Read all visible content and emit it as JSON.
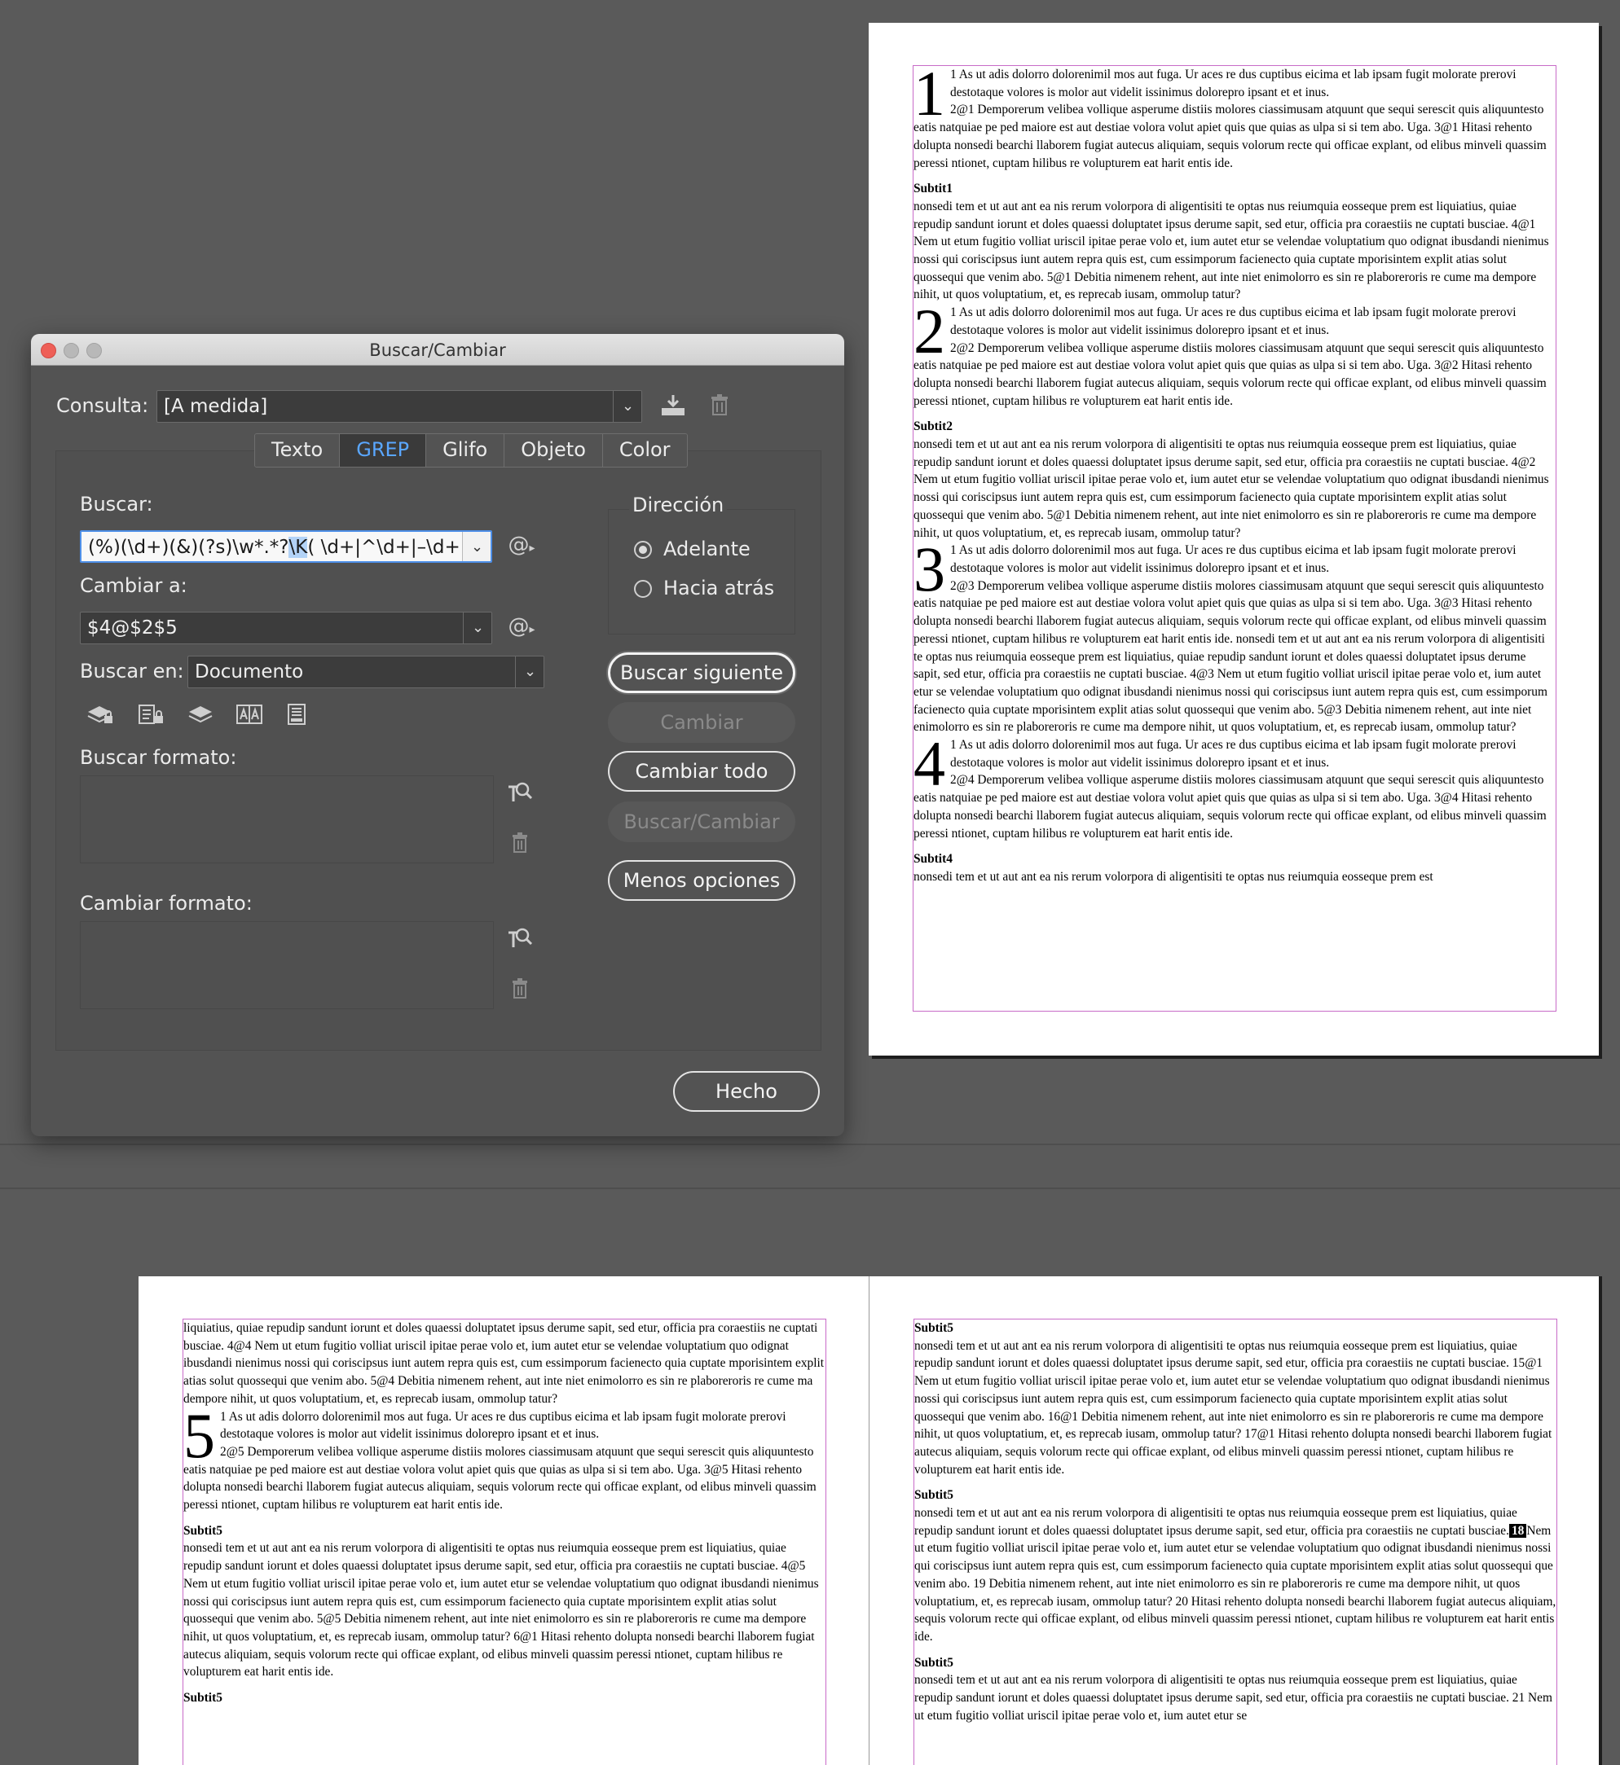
{
  "dialog": {
    "title": "Buscar/Cambiar",
    "query_label": "Consulta:",
    "query_value": "[A medida]",
    "tabs": [
      {
        "label": "Texto"
      },
      {
        "label": "GREP"
      },
      {
        "label": "Glifo"
      },
      {
        "label": "Objeto"
      },
      {
        "label": "Color"
      }
    ],
    "find_label": "Buscar:",
    "find_before": "(%)(\\d+)(&)(?s)\\w*.*?",
    "find_selected": "\\K",
    "find_after": "( \\d+|^\\d+|–\\d+",
    "change_label": "Cambiar a:",
    "change_value": "$4@$2$5",
    "search_in_label": "Buscar en:",
    "search_in_value": "Documento",
    "find_format_label": "Buscar formato:",
    "change_format_label": "Cambiar formato:",
    "direction_label": "Dirección",
    "forward_label": "Adelante",
    "backward_label": "Hacia atrás",
    "btn_find_next": "Buscar siguiente",
    "btn_change": "Cambiar",
    "btn_change_all": "Cambiar todo",
    "btn_find_change": "Buscar/Cambiar",
    "btn_fewer": "Menos opciones",
    "btn_done": "Hecho",
    "special_char_glyph": "@",
    "dropdown_glyph": "⌄"
  },
  "doc": {
    "top_page": {
      "sections": [
        {
          "num": "1",
          "p1": "1 As ut adis dolorro dolorenimil mos aut fuga. Ur aces re dus cuptibus eicima et lab ipsam fugit molorate prerovi destotaque volores is molor aut videlit issinimus dolorepro ipsant et et inus.",
          "p2": "2@1 Demporerum velibea vollique asperume distiis molores ciassimusam atquunt que sequi serescit quis aliquuntesto eatis natquiae pe ped maiore est aut destiae volora volut apiet quis que quias as ulpa si si tem abo. Uga. 3@1 Hitasi rehento dolupta nonsedi bearchi llaborem fugiat autecus aliquiam, sequis volorum recte qui officae explant, od elibus minveli quassim peressi ntionet, cuptam hilibus re volupturem eat harit entis ide.",
          "sub": "Subtit1",
          "p3": "nonsedi tem et ut aut ant ea nis rerum volorpora di aligentisiti te optas nus reiumquia eosseque prem est liquiatius, quiae repudip sandunt iorunt et doles quaessi doluptatet ipsus derume sapit, sed etur, officia pra coraestiis ne cuptati busciae. 4@1 Nem ut etum fugitio volliat uriscil ipitae perae volo et, ium autet etur se velendae voluptatium quo odignat ibusdandi nienimus nossi qui coriscipsus iunt autem repra quis est, cum essimporum facienecto quia cuptate mporisintem explit atias solut quossequi que venim abo. 5@1 Debitia nimenem rehent, aut inte niet enimolorro es sin re plaboreroris re cume ma dempore nihit, ut quos voluptatium, et, es reprecab iusam, ommolup tatur?"
        },
        {
          "num": "2",
          "p1": "1 As ut adis dolorro dolorenimil mos aut fuga. Ur aces re dus cuptibus eicima et lab ipsam fugit molorate prerovi destotaque volores is molor aut videlit issinimus dolorepro ipsant et et inus.",
          "p2": "2@2 Demporerum velibea vollique asperume distiis molores ciassimusam atquunt que sequi serescit quis aliquuntesto eatis natquiae pe ped maiore est aut destiae volora volut apiet quis que quias as ulpa si si tem abo. Uga. 3@2 Hitasi rehento dolupta nonsedi bearchi llaborem fugiat autecus aliquiam, sequis volorum recte qui officae explant, od elibus minveli quassim peressi ntionet, cuptam hilibus re volupturem eat harit entis ide.",
          "sub": "Subtit2",
          "p3": "nonsedi tem et ut aut ant ea nis rerum volorpora di aligentisiti te optas nus reiumquia eosseque prem est liquiatius, quiae repudip sandunt iorunt et doles quaessi doluptatet ipsus derume sapit, sed etur, officia pra coraestiis ne cuptati busciae. 4@2 Nem ut etum fugitio volliat uriscil ipitae perae volo et, ium autet etur se velendae voluptatium quo odignat ibusdandi nienimus nossi qui coriscipsus iunt autem repra quis est, cum essimporum facienecto quia cuptate mporisintem explit atias solut quossequi que venim abo. 5@1 Debitia nimenem rehent, aut inte niet enimolorro es sin re plaboreroris re cume ma dempore nihit, ut quos voluptatium, et, es reprecab iusam, ommolup tatur?"
        },
        {
          "num": "3",
          "p1": "1 As ut adis dolorro dolorenimil mos aut fuga. Ur aces re dus cuptibus eicima et lab ipsam fugit molorate prerovi destotaque volores is molor aut videlit issinimus dolorepro ipsant et et inus.",
          "p2": "2@3 Demporerum velibea vollique asperume distiis molores ciassimusam atquunt que sequi serescit quis aliquuntesto eatis natquiae pe ped maiore est aut destiae volora volut apiet quis que quias as ulpa si si tem abo. Uga. 3@3 Hitasi rehento dolupta nonsedi bearchi llaborem fugiat autecus aliquiam, sequis volorum recte qui officae explant, od elibus minveli quassim peressi ntionet, cuptam hilibus re volupturem eat harit entis ide. nonsedi tem et ut aut ant ea nis rerum volorpora di aligentisiti te optas nus reiumquia eosseque prem est liquiatius, quiae repudip sandunt iorunt et doles quaessi doluptatet ipsus derume sapit, sed etur, officia pra coraestiis ne cuptati busciae. 4@3 Nem ut etum fugitio volliat uriscil ipitae perae volo et, ium autet etur se velendae voluptatium quo odignat ibusdandi nienimus nossi qui coriscipsus iunt autem repra quis est, cum essimporum facienecto quia cuptate mporisintem explit atias solut quossequi que venim abo. 5@3 Debitia nimenem rehent, aut inte niet enimolorro es sin re plaboreroris re cume ma dempore nihit, ut quos voluptatium, et, es reprecab iusam, ommolup tatur?",
          "sub": "",
          "p3": ""
        },
        {
          "num": "4",
          "p1": "1 As ut adis dolorro dolorenimil mos aut fuga. Ur aces re dus cuptibus eicima et lab ipsam fugit molorate prerovi destotaque volores is molor aut videlit issinimus dolorepro ipsant et et inus.",
          "p2": "2@4 Demporerum velibea vollique asperume distiis molores ciassimusam atquunt que sequi serescit quis aliquuntesto eatis natquiae pe ped maiore est aut destiae volora volut apiet quis que quias as ulpa si si tem abo. Uga. 3@4 Hitasi rehento dolupta nonsedi bearchi llaborem fugiat autecus aliquiam, sequis volorum recte qui officae explant, od elibus minveli quassim peressi ntionet, cuptam hilibus re volupturem eat harit entis ide.",
          "sub": "Subtit4",
          "p3": "nonsedi tem et ut aut ant ea nis rerum volorpora di aligentisiti te optas nus reiumquia eosseque prem est"
        }
      ]
    },
    "bottom_left": {
      "intro": "liquiatius, quiae repudip sandunt iorunt et doles quaessi doluptatet ipsus derume sapit, sed etur, officia pra coraestiis ne cuptati busciae. 4@4 Nem ut etum fugitio volliat uriscil ipitae perae volo et, ium autet etur se velendae voluptatium quo odignat ibusdandi nienimus nossi qui coriscipsus iunt autem repra quis est, cum essimporum facienecto quia cuptate mporisintem explit atias solut quossequi que venim abo. 5@4 Debitia nimenem rehent, aut inte niet enimolorro es sin re plaboreroris re cume ma dempore nihit, ut quos voluptatium, et, es reprecab iusam, ommolup tatur?",
      "num": "5",
      "p1": "1 As ut adis dolorro dolorenimil mos aut fuga. Ur aces re dus cuptibus eicima et lab ipsam fugit molorate prerovi destotaque volores is molor aut videlit issinimus dolorepro ipsant et et inus.",
      "p2": "2@5 Demporerum velibea vollique asperume distiis molores ciassimusam atquunt que sequi serescit quis aliquuntesto eatis natquiae pe ped maiore est aut destiae volora volut apiet quis que quias as ulpa si si tem abo. Uga. 3@5 Hitasi rehento dolupta nonsedi bearchi llaborem fugiat autecus aliquiam, sequis volorum recte qui officae explant, od elibus minveli quassim peressi ntionet, cuptam hilibus re volupturem eat harit entis ide.",
      "sub": "Subtit5",
      "p3": "nonsedi tem et ut aut ant ea nis rerum volorpora di aligentisiti te optas nus reiumquia eosseque prem est liquiatius, quiae repudip sandunt iorunt et doles quaessi doluptatet ipsus derume sapit, sed etur, officia pra coraestiis ne cuptati busciae. 4@5 Nem ut etum fugitio volliat uriscil ipitae perae volo et, ium autet etur se velendae voluptatium quo odignat ibusdandi nienimus nossi qui coriscipsus iunt autem repra quis est, cum essimporum facienecto quia cuptate mporisintem explit atias solut quossequi que venim abo. 5@5 Debitia nimenem rehent, aut inte niet enimolorro es sin re plaboreroris re cume ma dempore nihit, ut quos voluptatium, et, es reprecab iusam, ommolup tatur? 6@1 Hitasi rehento dolupta nonsedi bearchi llaborem fugiat autecus aliquiam, sequis volorum recte qui officae explant, od elibus minveli quassim peressi ntionet, cuptam hilibus re volupturem eat harit entis ide.",
      "sub2": "Subtit5"
    },
    "bottom_right": {
      "sub_a": "Subtit5",
      "pa": "nonsedi tem et ut aut ant ea nis rerum volorpora di aligentisiti te optas nus reiumquia eosseque prem est liquiatius, quiae repudip sandunt iorunt et doles quaessi doluptatet ipsus derume sapit, sed etur, officia pra coraestiis ne cuptati busciae. 15@1 Nem ut etum fugitio volliat uriscil ipitae perae volo et, ium autet etur se velendae voluptatium quo odignat ibusdandi nienimus nossi qui coriscipsus iunt autem repra quis est, cum essimporum facienecto quia cuptate mporisintem explit atias solut quossequi que venim abo. 16@1 Debitia nimenem rehent, aut inte niet enimolorro es sin re plaboreroris re cume ma dempore nihit, ut quos voluptatium, et, es reprecab iusam, ommolup tatur? 17@1 Hitasi rehento dolupta nonsedi bearchi llaborem fugiat autecus aliquiam, sequis volorum recte qui officae explant, od elibus minveli quassim peressi ntionet, cuptam hilibus re volupturem eat harit entis ide.",
      "sub_b": "Subtit5",
      "pb_before": "nonsedi tem et ut aut ant ea nis rerum volorpora di aligentisiti te optas nus reiumquia eosseque prem est liquiatius, quiae repudip sandunt iorunt et doles quaessi doluptatet ipsus derume sapit, sed etur, officia pra coraestiis ne cuptati busciae.",
      "pb_highlight": "18",
      "pb_after": "Nem ut etum fugitio volliat uriscil ipitae perae volo et, ium autet etur se velendae voluptatium quo odignat ibusdandi nienimus nossi qui coriscipsus iunt autem repra quis est, cum essimporum facienecto quia cuptate mporisintem explit atias solut quossequi que venim abo. 19 Debitia nimenem rehent, aut inte niet enimolorro es sin re plaboreroris re cume ma dempore nihit, ut quos voluptatium, et, es reprecab iusam, ommolup tatur? 20 Hitasi rehento dolupta nonsedi bearchi llaborem fugiat autecus aliquiam, sequis volorum recte qui officae explant, od elibus minveli quassim peressi ntionet, cuptam hilibus re volupturem eat harit entis ide.",
      "sub_c": "Subtit5",
      "pc": "nonsedi tem et ut aut ant ea nis rerum volorpora di aligentisiti te optas nus reiumquia eosseque prem est liquiatius, quiae repudip sandunt iorunt et doles quaessi doluptatet ipsus derume sapit, sed etur, officia pra coraestiis ne cuptati busciae. 21 Nem ut etum fugitio volliat uriscil ipitae perae volo et, ium autet etur se"
    }
  }
}
